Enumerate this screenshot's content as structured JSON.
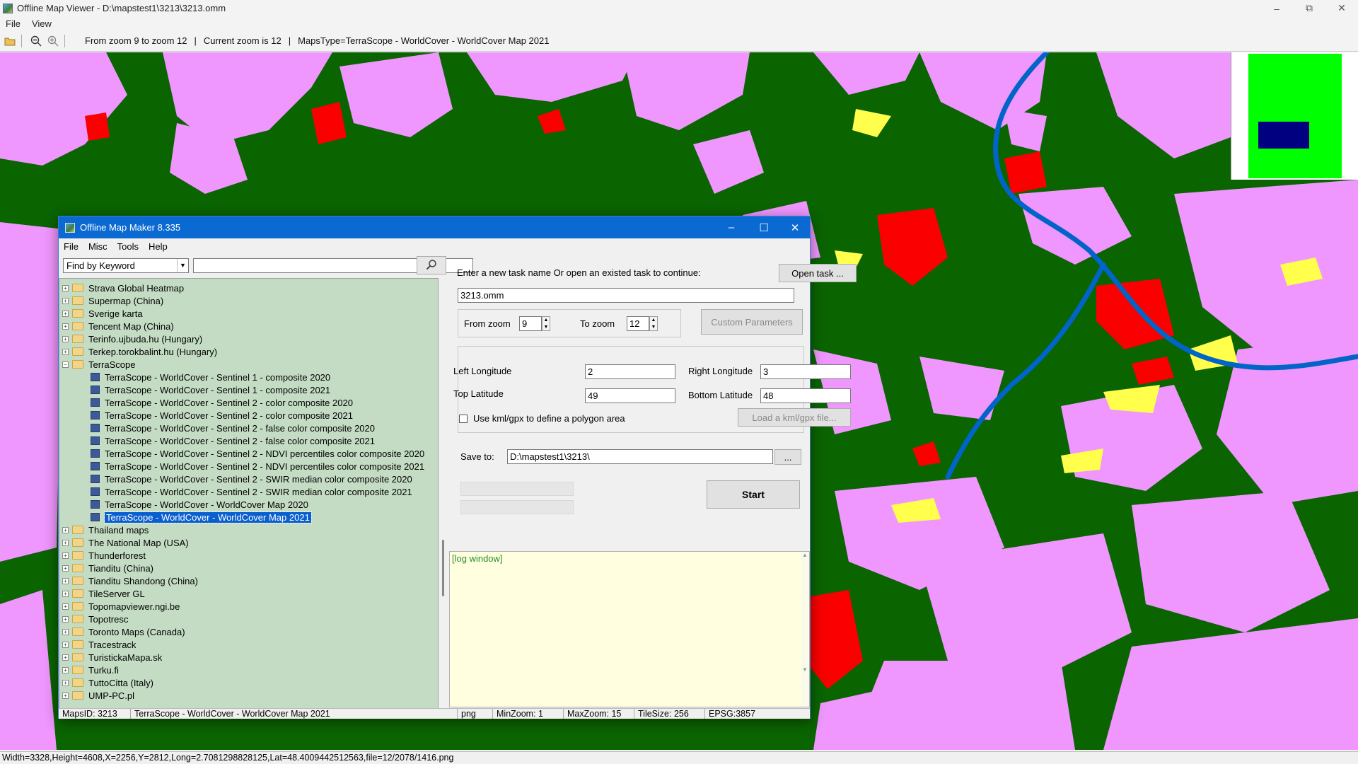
{
  "viewer": {
    "title": "Offline Map Viewer - D:\\mapstest1\\3213\\3213.omm",
    "menu": [
      "File",
      "View"
    ],
    "toolbar_info": [
      "From zoom 9 to zoom 12",
      "|",
      "Current zoom is 12",
      "|",
      "MapsType=TerraScope - WorldCover - WorldCover Map 2021"
    ],
    "status": "Width=3328,Height=4608,X=2256,Y=2812,Long=2.7081298828125,Lat=48.4009442512563,file=12/2078/1416.png",
    "colors": {
      "map_forest": "#0a6400",
      "map_cropland": "#f096ff",
      "map_builtup": "#fa0000",
      "map_grass": "#ffff4c",
      "map_water": "#0064c8",
      "overview_fill": "#00ff00",
      "overview_rect": "#000080"
    }
  },
  "dialog": {
    "title": "Offline Map Maker 8.335",
    "menu": [
      "File",
      "Misc",
      "Tools",
      "Help"
    ],
    "find_by": "Find by Keyword",
    "keyword_value": "",
    "tree": [
      {
        "label": "Strava Global Heatmap",
        "kind": "folder",
        "expanded": false
      },
      {
        "label": "Supermap (China)",
        "kind": "folder",
        "expanded": false
      },
      {
        "label": "Sverige karta",
        "kind": "folder",
        "expanded": false
      },
      {
        "label": "Tencent Map (China)",
        "kind": "folder",
        "expanded": false
      },
      {
        "label": "Terinfo.ujbuda.hu (Hungary)",
        "kind": "folder",
        "expanded": false
      },
      {
        "label": "Terkep.torokbalint.hu (Hungary)",
        "kind": "folder",
        "expanded": false
      },
      {
        "label": "TerraScope",
        "kind": "folder",
        "expanded": true
      },
      {
        "label": "TerraScope - WorldCover - Sentinel 1 - composite 2020",
        "kind": "map"
      },
      {
        "label": "TerraScope - WorldCover - Sentinel 1 - composite 2021",
        "kind": "map"
      },
      {
        "label": "TerraScope - WorldCover - Sentinel 2 - color composite 2020",
        "kind": "map"
      },
      {
        "label": "TerraScope - WorldCover - Sentinel 2 - color composite 2021",
        "kind": "map"
      },
      {
        "label": "TerraScope - WorldCover - Sentinel 2 - false color composite 2020",
        "kind": "map"
      },
      {
        "label": "TerraScope - WorldCover - Sentinel 2 - false color composite 2021",
        "kind": "map"
      },
      {
        "label": "TerraScope - WorldCover - Sentinel 2 - NDVI percentiles color composite 2020",
        "kind": "map"
      },
      {
        "label": "TerraScope - WorldCover - Sentinel 2 - NDVI percentiles color composite 2021",
        "kind": "map"
      },
      {
        "label": "TerraScope - WorldCover - Sentinel 2 - SWIR median color composite 2020",
        "kind": "map"
      },
      {
        "label": "TerraScope - WorldCover - Sentinel 2 - SWIR median color composite 2021",
        "kind": "map"
      },
      {
        "label": "TerraScope - WorldCover - WorldCover Map 2020",
        "kind": "map"
      },
      {
        "label": "TerraScope - WorldCover - WorldCover Map 2021",
        "kind": "map",
        "selected": true
      },
      {
        "label": "Thailand maps",
        "kind": "folder",
        "expanded": false
      },
      {
        "label": "The National Map (USA)",
        "kind": "folder",
        "expanded": false
      },
      {
        "label": "Thunderforest",
        "kind": "folder",
        "expanded": false
      },
      {
        "label": "Tianditu (China)",
        "kind": "folder",
        "expanded": false
      },
      {
        "label": "Tianditu Shandong (China)",
        "kind": "folder",
        "expanded": false
      },
      {
        "label": "TileServer GL",
        "kind": "folder",
        "expanded": false
      },
      {
        "label": "Topomapviewer.ngi.be",
        "kind": "folder",
        "expanded": false
      },
      {
        "label": "Topotresc",
        "kind": "folder",
        "expanded": false
      },
      {
        "label": "Toronto Maps (Canada)",
        "kind": "folder",
        "expanded": false
      },
      {
        "label": "Tracestrack",
        "kind": "folder",
        "expanded": false
      },
      {
        "label": "TuristickaMapa.sk",
        "kind": "folder",
        "expanded": false
      },
      {
        "label": "Turku.fi",
        "kind": "folder",
        "expanded": false
      },
      {
        "label": "TuttoCitta (Italy)",
        "kind": "folder",
        "expanded": false
      },
      {
        "label": "UMP-PC.pl",
        "kind": "folder",
        "expanded": false
      }
    ],
    "task_prompt": "Enter a new task name Or open an existed task to continue:",
    "open_task_button": "Open task ...",
    "task_name": "3213.omm",
    "from_zoom_label": "From zoom",
    "from_zoom": "9",
    "to_zoom_label": "To zoom",
    "to_zoom": "12",
    "custom_params_button": "Custom Parameters",
    "left_lon_label": "Left Longitude",
    "left_lon": "2",
    "right_lon_label": "Right Longitude",
    "right_lon": "3",
    "top_lat_label": "Top Latitude",
    "top_lat": "49",
    "bottom_lat_label": "Bottom Latitude",
    "bottom_lat": "48",
    "kml_checkbox_label": "Use kml/gpx to define a polygon area",
    "kml_checked": false,
    "load_kml_button": "Load a kml/gpx file...",
    "save_to_label": "Save to:",
    "save_to": "D:\\mapstest1\\3213\\",
    "browse_button": "...",
    "start_button": "Start",
    "log_text": "[log window]",
    "status": [
      "MapsID: 3213",
      "TerraScope - WorldCover - WorldCover Map 2021",
      "png",
      "MinZoom: 1",
      "MaxZoom: 15",
      "TileSize: 256",
      "EPSG:3857"
    ]
  }
}
